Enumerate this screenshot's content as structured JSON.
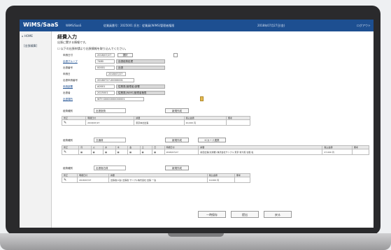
{
  "topbar": {
    "logo": "WiMS/SaaS",
    "items": [
      "WiMS/SaaS",
      "従業員番号：2025001 氏名：従業員(WiMS)管理者権限",
      "2018年07月27日(金)",
      "ログアウト"
    ]
  },
  "sidebar": {
    "home": "⌂ HOME",
    "item": "[出張精算]"
  },
  "main": {
    "title": "経費入力",
    "line1": "出張に関する情報です。",
    "line2": "☐ 以下の出張申請より出張情報を取り込んでください。",
    "form": [
      {
        "label": "申請日付",
        "value": "2018/07/27",
        "extra": "選択",
        "link": false
      },
      {
        "label": "出張グループ",
        "value": "7480",
        "extra": "出張経費処理",
        "link": true
      },
      {
        "label": "出張番号",
        "value": "00001",
        "extra": "出張",
        "link": false
      },
      {
        "label": "申請日",
        "value": "2018/07/27",
        "extra": "",
        "link": false
      },
      {
        "label": "出張申請番号",
        "value": "20180727-00000001",
        "extra": "",
        "link": false
      },
      {
        "label": "申請部署",
        "value": "A0001",
        "extra": "従業員(管理者)部署",
        "link": true
      },
      {
        "label": "出張者",
        "value": "2025001",
        "extra": "従業員(WiMS)管理者権限",
        "link": false
      },
      {
        "label": "出張場所",
        "value": "WTY-S0000000000001",
        "extra": "",
        "link": true
      }
    ],
    "sections": [
      {
        "type_label": "経費種別",
        "type_value": "出張旅費",
        "new_btn": "新規作成",
        "extra_btn": "",
        "headers": [
          "修正",
          "明細日付",
          "摘要",
          "税込金額",
          "備考"
        ],
        "rows": [
          [
            "2018/07/27",
            "東京本社出張",
            "20,000 円",
            ""
          ]
        ]
      },
      {
        "type_label": "経費種別",
        "type_value": "交通費",
        "new_btn": "新規作成",
        "extra_btn": "ICカード連携",
        "headers": [
          "修正",
          "月",
          "火",
          "水",
          "木",
          "金",
          "土",
          "日",
          "明細日付",
          "摘要",
          "税込金額",
          "備考"
        ],
        "rows": [
          [
            "2018/07/27",
            "雇自出張[交通費] 株式会社サンプル 東京 新大阪 往復 電",
            "27,000 円",
            ""
          ]
        ]
      },
      {
        "type_label": "経費種別",
        "type_value": "出張宿泊費",
        "new_btn": "新規作成",
        "extra_btn": "",
        "headers": [
          "修正",
          "明細日付",
          "摘要",
          "税込金額",
          "備考"
        ],
        "rows": [
          [
            "2018/07/27",
            "出張宿(1泊) 出張宿 サンプル株式会社 出張 一泊",
            "10,000 円",
            ""
          ]
        ]
      }
    ],
    "footer_buttons": [
      "一時保存",
      "提出",
      "戻る"
    ]
  }
}
